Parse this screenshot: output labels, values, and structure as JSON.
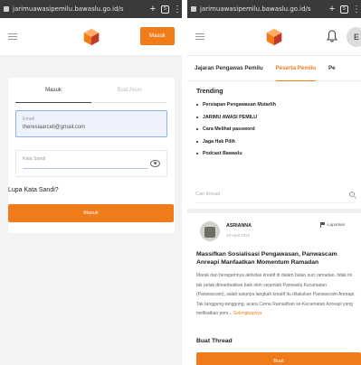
{
  "left_screen": {
    "chrome": {
      "url": "jarimuawasipemilu.bawaslu.go.id/s",
      "new_tab": "+",
      "tab_count": "5"
    },
    "header": {
      "login_button": "Masuk"
    },
    "login": {
      "tab_login": "Masuk",
      "tab_register": "Buat Akun",
      "email_label": "Email",
      "email_value": "theresiaarcell@gmail.com",
      "password_label": "Kata Sandi",
      "forgot_password": "Lupa Kata Sandi?",
      "submit": "Masuk"
    }
  },
  "right_screen": {
    "chrome": {
      "url": "jarimuawasipemilu.bawaslu.go.id/s",
      "new_tab": "+",
      "tab_count": "5"
    },
    "header": {
      "avatar_initial": "E"
    },
    "tabs": [
      "Jajaran Pengawas Pemilu",
      "Peserta Pemilu",
      "Pe"
    ],
    "trending": {
      "title": "Trending",
      "items": [
        "Persiapan Pengawasan Mutarlih",
        "JARIMU AWASI PEMILU",
        "Cara Melihat password",
        "Jaga Hak Pilih",
        "Podcast Bawaslu"
      ]
    },
    "search": {
      "placeholder": "Cari thread"
    },
    "post": {
      "author": "ASRIANNA",
      "date": "29 April 2022",
      "report": "Laporkan",
      "title": "Massifkan Sosialisasi Pengawasan, Panwascam Anreapi Manfaatkan Momentum Ramadan",
      "body": "Marak dan beragamnya aktivitas kreatif di dalam bulan suci ramadan, tidak ini tak pelak dimanfaatkan baik oleh sejumlah Panwaslu Kecamatan (Panwascam), salah satunya langkah kreatif itu dilakukan Panwascam Anreapi. Tak tanggung-tanggung, acara Cerna Ramadhan se-Kecamatan Anreapi yang melibatkan pem...",
      "more": "Selengkapnya"
    },
    "create": {
      "label": "Buat Thread",
      "button": "Buat"
    }
  },
  "colors": {
    "brand": "#f07c19",
    "chrome": "#3a3a3a"
  }
}
